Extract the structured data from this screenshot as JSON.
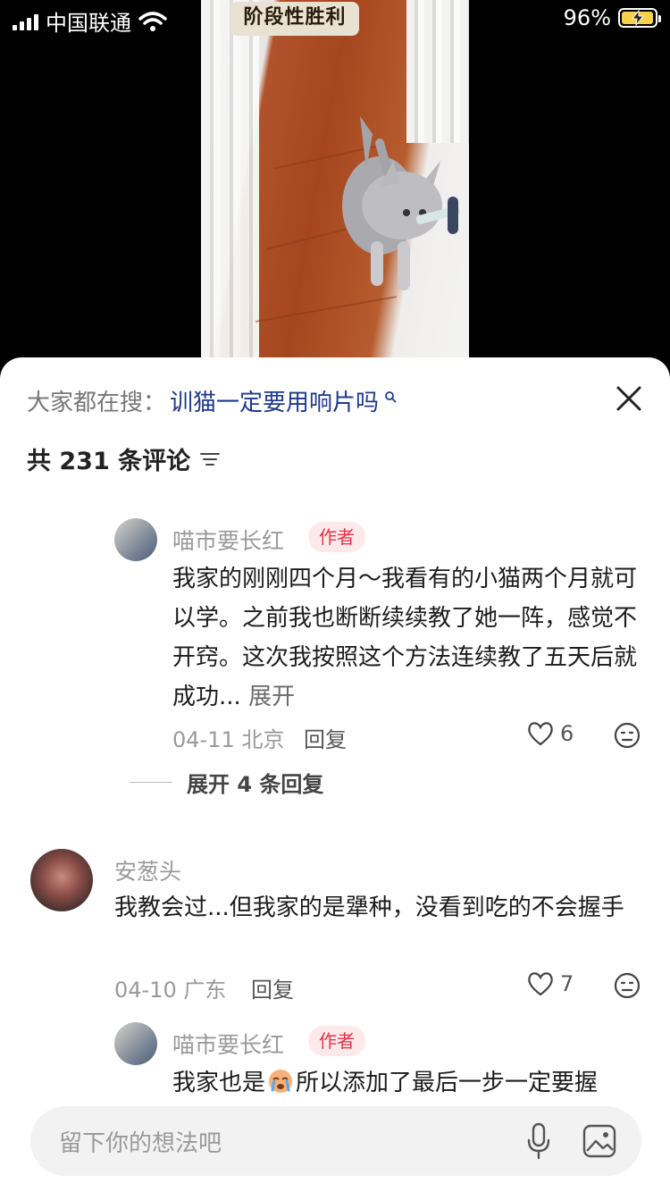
{
  "status_bar": {
    "carrier": "中国联通",
    "battery": "96%"
  },
  "video": {
    "overlay_title": "阶段性胜利"
  },
  "sheet": {
    "search_prefix": "大家都在搜：",
    "search_term": "训猫一定要用响片吗",
    "comment_count": "共 231 条评论",
    "comments": [
      {
        "user": "喵市要长红",
        "badge": "作者",
        "text": "我家的刚刚四个月～我看有的小猫两个月就可以学。之前我也断断续续教了她一阵，感觉不开窍。这次我按照这个方法连续教了五天后就成功...",
        "more": "展开",
        "meta": "04-11 北京",
        "reply": "回复",
        "likes": "6"
      },
      {
        "user": "安葱头",
        "text": "我教会过...但我家的是犟种，没看到吃的不会握手",
        "meta": "04-10 广东",
        "reply": "回复",
        "likes": "7"
      },
      {
        "user": "喵市要长红",
        "badge": "作者",
        "text_before": "我家也是",
        "text_after": "所以添加了最后一步一定要握"
      }
    ],
    "expand_replies": "展开 4 条回复",
    "input_placeholder": "留下你的想法吧"
  },
  "colors": {
    "accent": "#1e3a8a",
    "author_badge_text": "#e0344a",
    "author_badge_bg": "#fde8ea"
  }
}
